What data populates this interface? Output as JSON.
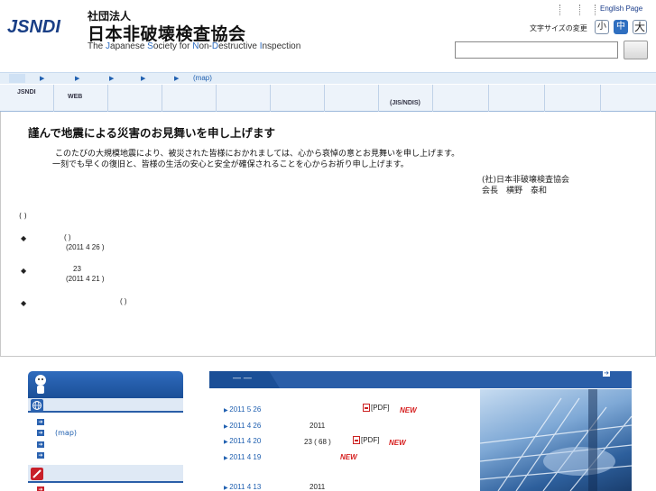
{
  "header": {
    "logo_text": "JSNDI",
    "org_name_small": "社団法人",
    "org_name": "日本非破壊検査協会",
    "org_name_en_parts": [
      {
        "text": "The ",
        "hl": false
      },
      {
        "text": "J",
        "hl": true
      },
      {
        "text": "apanese ",
        "hl": false
      },
      {
        "text": "S",
        "hl": true
      },
      {
        "text": "ociety for ",
        "hl": false
      },
      {
        "text": "N",
        "hl": true
      },
      {
        "text": "on-",
        "hl": false
      },
      {
        "text": "D",
        "hl": true
      },
      {
        "text": "estructive ",
        "hl": false
      },
      {
        "text": "I",
        "hl": true
      },
      {
        "text": "nspection",
        "hl": false
      }
    ],
    "english_link": "English Page",
    "font_size_label": "文字サイズの変更",
    "font_size_small": "小",
    "font_size_medium": "中",
    "font_size_large": "大",
    "search_value": ""
  },
  "breadcrumb": {
    "map_label": "(map)"
  },
  "gnav": {
    "items": [
      "JSNDI",
      "WEB",
      "",
      "",
      "",
      "",
      "",
      "(JIS/NDIS)",
      "",
      "",
      "",
      ""
    ]
  },
  "main": {
    "condolence_title": "謹んで地震による災害のお見舞いを申し上げます",
    "condolence_line1": "このたびの大規模地震により、被災された皆様におかれましては、心から哀悼の意とお見舞いを申し上げます。",
    "condolence_line2": "一刻でも早くの復旧と、皆様の生活の安心と安全が確保されることを心からお祈り申し上げます。",
    "condolence_org": "(社)日本非破壊検査協会",
    "condolence_sign": "会長　横野　泰和",
    "paren_note": "( )",
    "notices": [
      {
        "bullet": "◆",
        "line1": "(        )",
        "line2": "(2011  4 26   )"
      },
      {
        "bullet": "◆",
        "line1": "23",
        "line2": "(2011  4 21   )"
      },
      {
        "bullet": "◆",
        "line1": "(        )",
        "line2": ""
      }
    ]
  },
  "sidebar": {
    "map_label": "(map)"
  },
  "news": {
    "tab_label": "―  ―",
    "items": [
      {
        "date": "2011 5 26",
        "mid": "",
        "pdf": "[PDF]",
        "new": "NEW"
      },
      {
        "date": "2011 4 26",
        "mid": "2011",
        "pdf": "",
        "new": ""
      },
      {
        "date": "2011 4 20",
        "mid": "23  ( 68 )",
        "pdf": "[PDF]",
        "new": "NEW"
      },
      {
        "date": "2011 4 19",
        "mid": "",
        "pdf": "",
        "new": "NEW"
      },
      {
        "date": "2011 4 13",
        "mid": "2011",
        "pdf": "",
        "new": ""
      }
    ]
  },
  "colors": {
    "brand_blue": "#2a5ea8",
    "new_red": "#d62020",
    "link_blue": "#2060b0"
  },
  "icons": [
    "search-icon",
    "globe-icon",
    "pencil-icon",
    "mascot-icon",
    "pdf-icon",
    "arrow-right-icon"
  ]
}
